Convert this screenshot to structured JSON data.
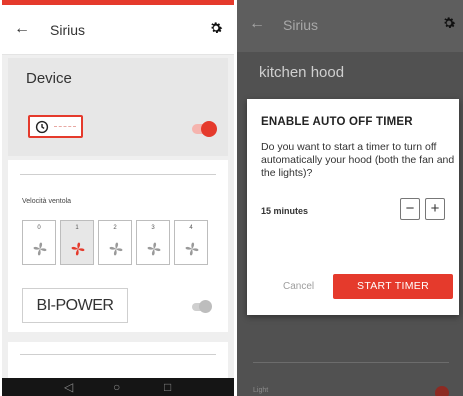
{
  "colors": {
    "accent": "#e53a2c",
    "left_bg": "#efefef",
    "overlay_bg": "#515151"
  },
  "left": {
    "appbar": {
      "back_icon": "arrow-left-icon",
      "title": "Sirius",
      "settings_icon": "gear-icon"
    },
    "device_card": {
      "title": "Device",
      "timer_icon": "clock-icon",
      "power_on": true
    },
    "fan_card": {
      "label": "Velocità ventola",
      "speeds": [
        "0",
        "1",
        "2",
        "3",
        "4"
      ],
      "selected_speed": "1",
      "bipower_label": "BI-POWER",
      "bipower_on": false
    },
    "navbar": {
      "back": "◁",
      "home": "○",
      "recents": "□"
    }
  },
  "right": {
    "appbar": {
      "back_icon": "arrow-left-icon",
      "title": "Sirius",
      "settings_icon": "gear-icon"
    },
    "device_name": "kitchen hood",
    "light_label": "Light",
    "dialog": {
      "title": "ENABLE AUTO OFF TIMER",
      "body": "Do you want to start a timer to turn off automatically your hood (both the fan and the lights)?",
      "duration": "15 minutes",
      "minus": "−",
      "plus": "+",
      "cancel": "Cancel",
      "start": "START TIMER"
    }
  }
}
